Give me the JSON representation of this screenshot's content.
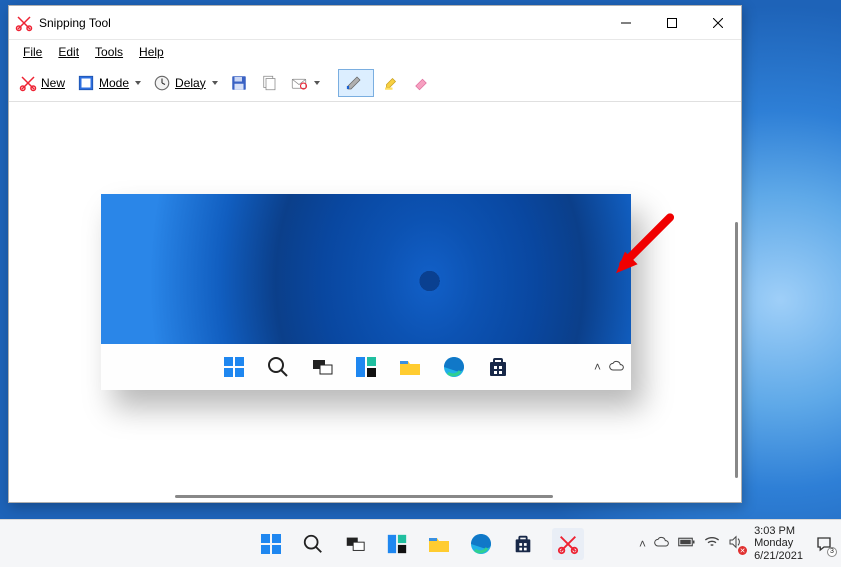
{
  "window": {
    "title": "Snipping Tool"
  },
  "menu": {
    "file": "File",
    "edit": "Edit",
    "tools": "Tools",
    "help": "Help"
  },
  "toolbar": {
    "new_label": "New",
    "mode_label": "Mode",
    "delay_label": "Delay"
  },
  "os": {
    "time": "3:03 PM",
    "day": "Monday",
    "date": "6/21/2021",
    "notif_count": "3"
  }
}
